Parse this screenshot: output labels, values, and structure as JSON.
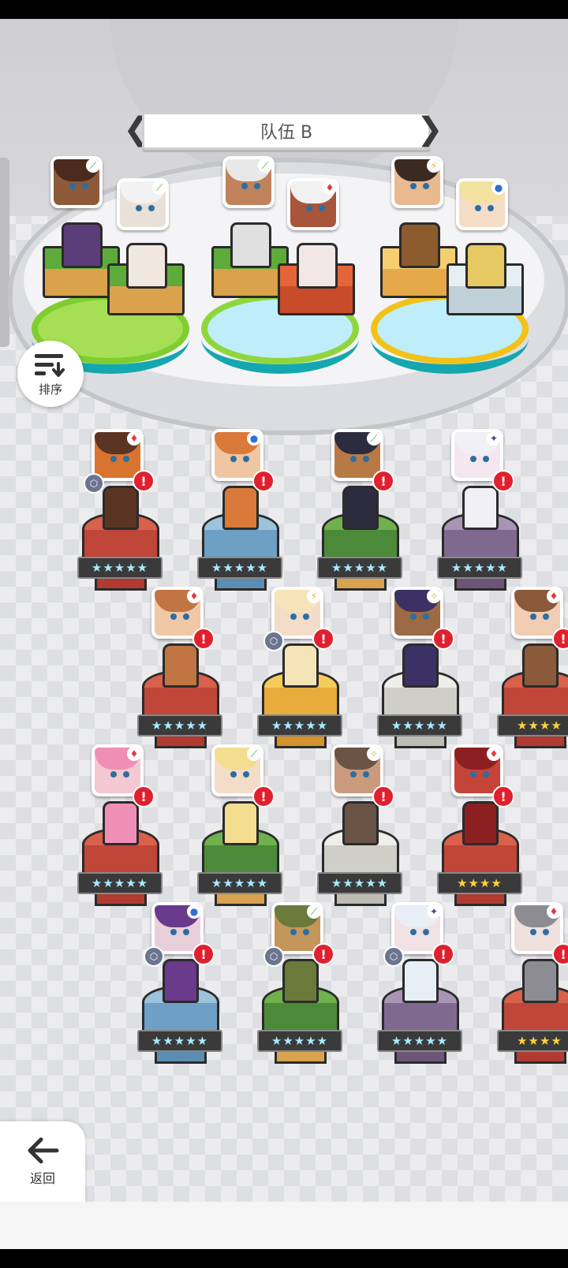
{
  "team": {
    "title": "队伍 B",
    "members": [
      {
        "element": "grass",
        "face": "#8c5a3a",
        "hair": "#4a2b1e",
        "block": "b-grass",
        "sprite": "#5b3d7a"
      },
      {
        "element": "grass",
        "face": "#e9e0d8",
        "hair": "#f2f2f2",
        "block": "b-grass",
        "sprite": "#f0e8e0"
      },
      {
        "element": "grass",
        "face": "#c0825a",
        "hair": "#e8e8e8",
        "block": "b-grass",
        "sprite": "#e0e0e0"
      },
      {
        "element": "fire",
        "face": "#a8553c",
        "hair": "#f2f2f2",
        "block": "b-fire",
        "sprite": "#f1e7e4"
      },
      {
        "element": "electric",
        "face": "#e9b990",
        "hair": "#3b2a22",
        "block": "b-sand",
        "sprite": "#8c5b2e"
      },
      {
        "element": "water",
        "face": "#f4dcc7",
        "hair": "#f3e2a0",
        "block": "b-ice",
        "sprite": "#e6c963"
      }
    ]
  },
  "buttons": {
    "sort_label": "排序",
    "back_label": "返回"
  },
  "roster": [
    {
      "element": "fire",
      "face": "#d9742f",
      "hair": "#5c3424",
      "pedestal": "c-fire",
      "stars": "★★★★★",
      "gold": false,
      "gear": true
    },
    {
      "element": "water",
      "face": "#f0c6a2",
      "hair": "#d97a3a",
      "pedestal": "c-water",
      "stars": "★★★★★",
      "gold": false,
      "gear": false
    },
    {
      "element": "grass",
      "face": "#b87a45",
      "hair": "#2c2c3e",
      "pedestal": "c-grass",
      "stars": "★★★★★",
      "gold": false,
      "gear": false
    },
    {
      "element": "dark",
      "face": "#f5e7ef",
      "hair": "#f0f0f5",
      "pedestal": "c-dark",
      "stars": "★★★★★",
      "gold": false,
      "gear": false
    },
    {
      "element": "fire",
      "face": "#f0c8a5",
      "hair": "#c07543",
      "pedestal": "c-fire",
      "stars": "★★★★★",
      "gold": false,
      "gear": false
    },
    {
      "element": "electric",
      "face": "#f3dcc8",
      "hair": "#f5e4b8",
      "pedestal": "c-sun",
      "stars": "★★★★★",
      "gold": false,
      "gear": true
    },
    {
      "element": "light",
      "face": "#9c6a45",
      "hair": "#3c3164",
      "pedestal": "c-light",
      "stars": "★★★★★",
      "gold": false,
      "gear": false
    },
    {
      "element": "fire",
      "face": "#f0cdb3",
      "hair": "#8b5a3a",
      "pedestal": "c-fire",
      "stars": "★★★★",
      "gold": true,
      "gear": false
    },
    {
      "element": "fire",
      "face": "#f4c8d0",
      "hair": "#f08fb5",
      "pedestal": "c-fire",
      "stars": "★★★★★",
      "gold": false,
      "gear": false
    },
    {
      "element": "grass",
      "face": "#f3dcc8",
      "hair": "#f3dd8f",
      "pedestal": "c-grass",
      "stars": "★★★★★",
      "gold": false,
      "gear": false
    },
    {
      "element": "light",
      "face": "#c99b7c",
      "hair": "#6a5446",
      "pedestal": "c-light",
      "stars": "★★★★★",
      "gold": false,
      "gear": false
    },
    {
      "element": "fire",
      "face": "#c4443a",
      "hair": "#8c2020",
      "pedestal": "c-fire",
      "stars": "★★★★",
      "gold": true,
      "gear": false
    },
    {
      "element": "water",
      "face": "#e9cfd9",
      "hair": "#6a3a8c",
      "pedestal": "c-water",
      "stars": "★★★★★",
      "gold": false,
      "gear": true
    },
    {
      "element": "grass",
      "face": "#c4965c",
      "hair": "#6a7a3a",
      "pedestal": "c-grass",
      "stars": "★★★★★",
      "gold": false,
      "gear": true
    },
    {
      "element": "dark",
      "face": "#f0e2e4",
      "hair": "#e8eef5",
      "pedestal": "c-dark",
      "stars": "★★★★★",
      "gold": false,
      "gear": true
    },
    {
      "element": "fire",
      "face": "#eee0dc",
      "hair": "#8c8c92",
      "pedestal": "c-fire",
      "stars": "★★★★",
      "gold": true,
      "gear": false
    }
  ],
  "element_icons": {
    "grass": {
      "glyph": "⟋",
      "color": "#3aa02e"
    },
    "fire": {
      "glyph": "♦",
      "color": "#e23a3a"
    },
    "water": {
      "glyph": "●",
      "color": "#2f6fd6"
    },
    "dark": {
      "glyph": "✦",
      "color": "#5b3c7a"
    },
    "electric": {
      "glyph": "⚡",
      "color": "#f2b51a"
    },
    "light": {
      "glyph": "✧",
      "color": "#c8b54a"
    }
  },
  "alert_mark": "!"
}
